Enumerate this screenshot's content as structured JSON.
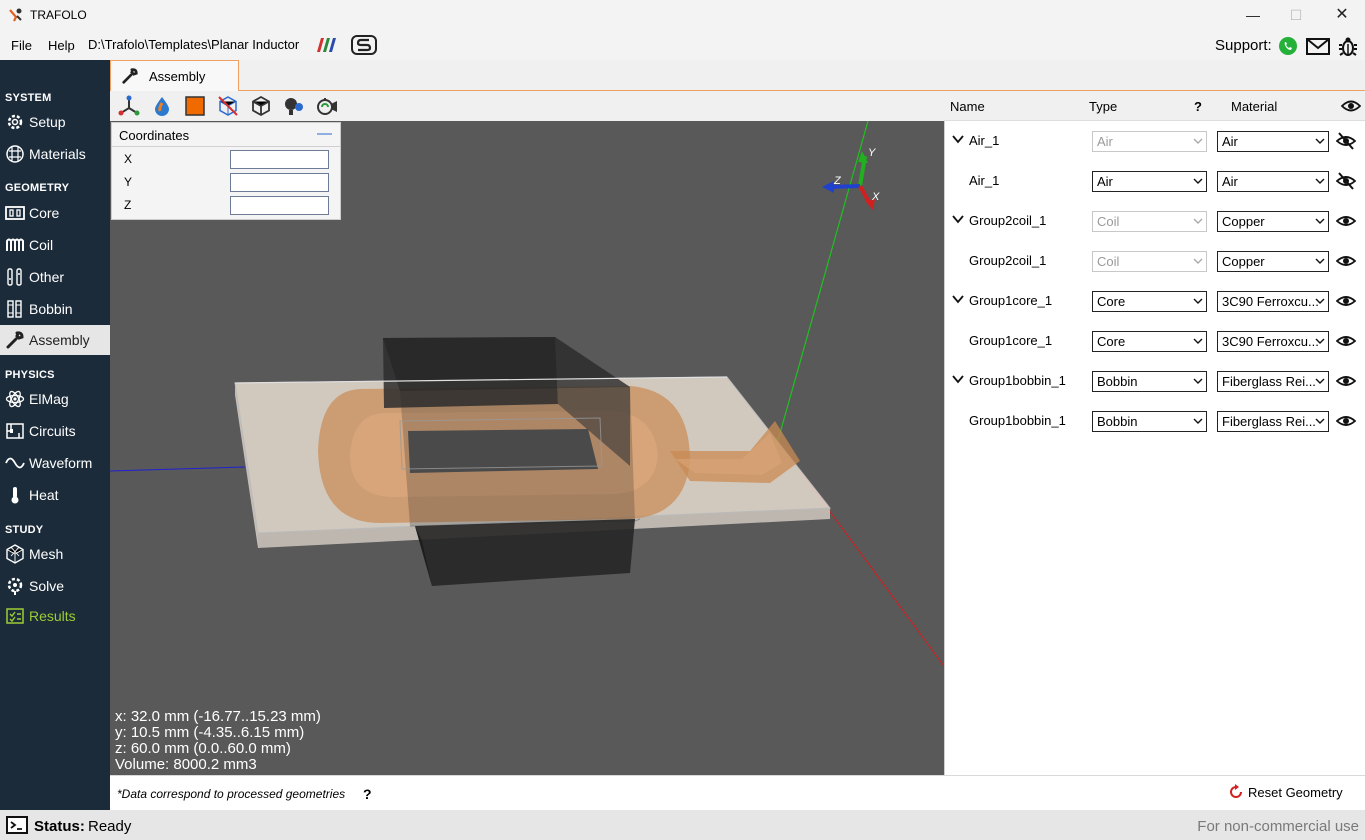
{
  "app": {
    "title": "TRAFOLO"
  },
  "window_controls": {
    "minimize": "—",
    "maximize": "☐",
    "close": "✕"
  },
  "menu": {
    "file": "File",
    "help": "Help",
    "path": "D:\\Trafolo\\Templates\\Planar Inductor"
  },
  "support": {
    "label": "Support:"
  },
  "sidebar": {
    "sections": [
      {
        "title": "SYSTEM",
        "items": [
          {
            "label": "Setup",
            "icon": "gear-icon"
          },
          {
            "label": "Materials",
            "icon": "grid-icon"
          }
        ]
      },
      {
        "title": "GEOMETRY",
        "items": [
          {
            "label": "Core",
            "icon": "core-icon"
          },
          {
            "label": "Coil",
            "icon": "coil-icon"
          },
          {
            "label": "Other",
            "icon": "other-icon"
          },
          {
            "label": "Bobbin",
            "icon": "bobbin-icon"
          },
          {
            "label": "Assembly",
            "icon": "wrench-icon",
            "active": true
          }
        ]
      },
      {
        "title": "PHYSICS",
        "items": [
          {
            "label": "ElMag",
            "icon": "atom-icon"
          },
          {
            "label": "Circuits",
            "icon": "circuit-icon"
          },
          {
            "label": "Waveform",
            "icon": "wave-icon"
          },
          {
            "label": "Heat",
            "icon": "thermometer-icon"
          }
        ]
      },
      {
        "title": "STUDY",
        "items": [
          {
            "label": "Mesh",
            "icon": "mesh-icon"
          },
          {
            "label": "Solve",
            "icon": "solve-icon"
          },
          {
            "label": "Results",
            "icon": "results-icon"
          }
        ]
      }
    ]
  },
  "tabs": [
    {
      "label": "Assembly",
      "icon": "wrench-icon"
    }
  ],
  "toolbar": {
    "buttons": [
      "axes-icon",
      "drop-icon",
      "square-icon",
      "no-mesh-icon",
      "cube-icon",
      "scene-icon",
      "camera-icon"
    ]
  },
  "coordinates": {
    "title": "Coordinates",
    "minimize": "—",
    "fields": [
      {
        "label": "X",
        "value": ""
      },
      {
        "label": "Y",
        "value": ""
      },
      {
        "label": "Z",
        "value": ""
      }
    ]
  },
  "axes_gizmo": {
    "y": "Y",
    "z": "Z",
    "x": "X"
  },
  "readout": {
    "x": "x: 32.0 mm (-16.77..15.23 mm)",
    "y": "y: 10.5 mm (-4.35..6.15 mm)",
    "z": "z: 60.0 mm (0.0..60.0 mm)",
    "volume": "Volume: 8000.2 mm3"
  },
  "tree_header": {
    "name": "Name",
    "type": "Type",
    "help": "?",
    "material": "Material"
  },
  "tree": [
    {
      "name": "Air_1",
      "type": "Air",
      "material": "Air",
      "expandable": true,
      "type_disabled": true,
      "visible": false
    },
    {
      "name": "Air_1",
      "type": "Air",
      "material": "Air",
      "expandable": false,
      "type_disabled": false,
      "visible": false
    },
    {
      "name": "Group2coil_1",
      "type": "Coil",
      "material": "Copper",
      "expandable": true,
      "type_disabled": true,
      "visible": true
    },
    {
      "name": "Group2coil_1",
      "type": "Coil",
      "material": "Copper",
      "expandable": false,
      "type_disabled": true,
      "visible": true
    },
    {
      "name": "Group1core_1",
      "type": "Core",
      "material": "3C90 Ferroxcu...",
      "expandable": true,
      "type_disabled": false,
      "visible": true
    },
    {
      "name": "Group1core_1",
      "type": "Core",
      "material": "3C90 Ferroxcu...",
      "expandable": false,
      "type_disabled": false,
      "visible": true
    },
    {
      "name": "Group1bobbin_1",
      "type": "Bobbin",
      "material": "Fiberglass Rei...",
      "expandable": true,
      "type_disabled": false,
      "visible": true
    },
    {
      "name": "Group1bobbin_1",
      "type": "Bobbin",
      "material": "Fiberglass Rei...",
      "expandable": false,
      "type_disabled": false,
      "visible": true
    }
  ],
  "footer": {
    "note": "*Data correspond to processed geometries",
    "help": "?",
    "reset": "Reset Geometry"
  },
  "status": {
    "label": "Status:",
    "value": "Ready",
    "license": "For non-commercial use"
  }
}
